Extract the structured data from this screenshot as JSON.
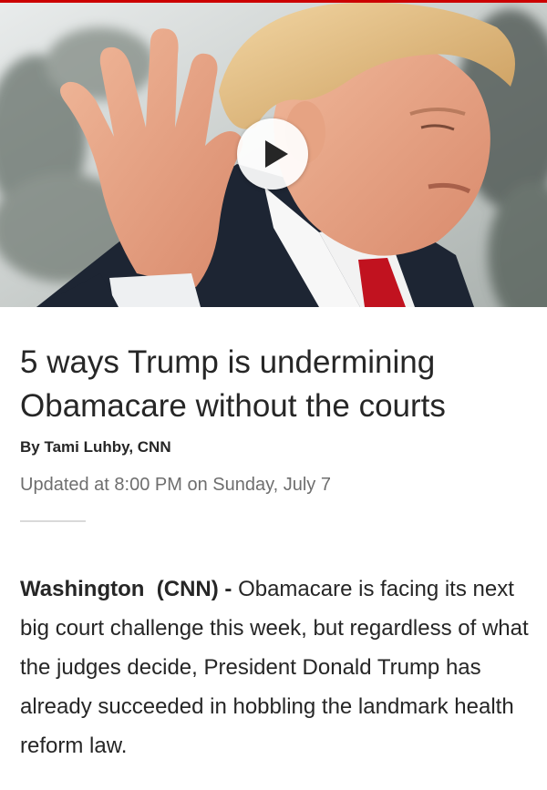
{
  "hero": {
    "image_alt": "Donald Trump waving",
    "play_icon": "play-icon"
  },
  "article": {
    "headline": "5 ways Trump is undermining Obamacare without the courts",
    "byline": "By Tami Luhby, CNN",
    "timestamp": "Updated at 8:00 PM on Sunday, July 7",
    "dateline": "Washington  (CNN) - ",
    "body": "Obamacare is facing its next big court challenge this week, but regardless of what the judges decide, President Donald Trump has already succeeded in hobbling the landmark health reform law."
  },
  "colors": {
    "accent": "#cc0000",
    "text": "#262626",
    "muted": "#6e6e6e"
  }
}
